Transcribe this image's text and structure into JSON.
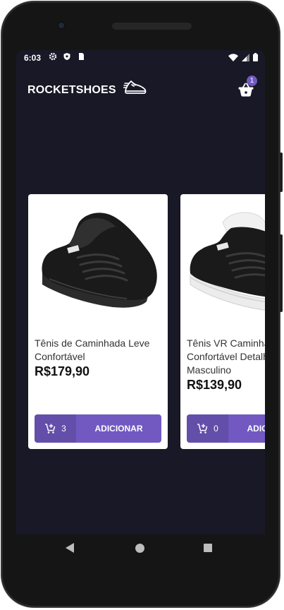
{
  "status_bar": {
    "time": "6:03"
  },
  "header": {
    "logo_text": "ROCKETSHOES",
    "cart_count": "1"
  },
  "products": [
    {
      "title": "Tênis de Caminhada Leve Confortável",
      "price": "R$179,90",
      "amount": "3",
      "button_label": "ADICIONAR"
    },
    {
      "title": "Tênis VR Caminhada Confortável Detalhes Couro Masculino",
      "price": "R$139,90",
      "amount": "0",
      "button_label": "ADICIONAR"
    }
  ],
  "colors": {
    "background": "#191826",
    "accent": "#7159c1"
  }
}
